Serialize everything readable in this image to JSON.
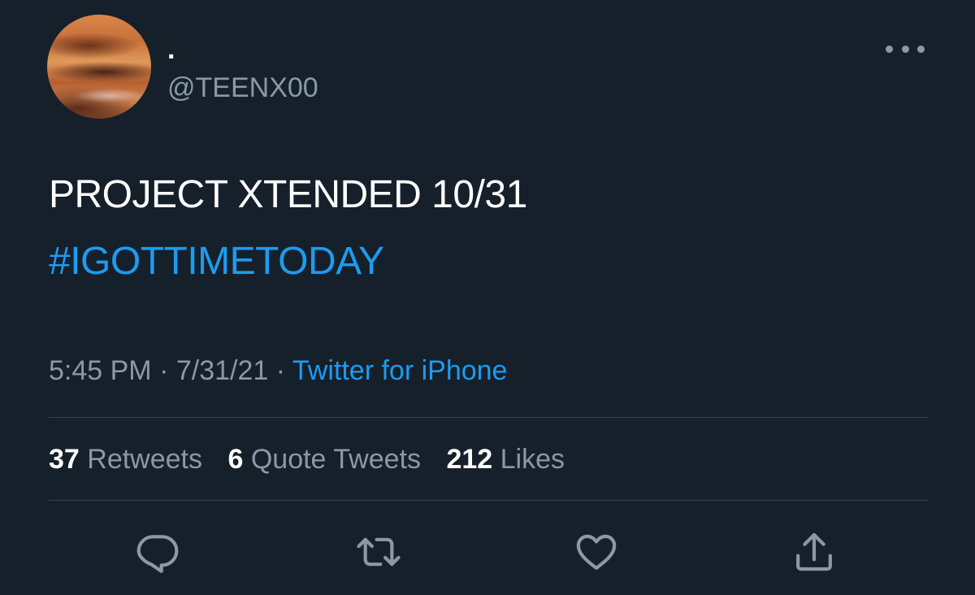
{
  "user": {
    "display_name": ".",
    "handle": "@TEENX00"
  },
  "tweet": {
    "text": "PROJECT XTENDED 10/31",
    "hashtag": "#IGOTTIMETODAY"
  },
  "meta": {
    "time": "5:45 PM",
    "separator1": " · ",
    "date": "7/31/21",
    "separator2": " · ",
    "source": "Twitter for iPhone"
  },
  "stats": {
    "retweets": {
      "count": "37",
      "label": " Retweets"
    },
    "quotes": {
      "count": "6",
      "label": " Quote Tweets"
    },
    "likes": {
      "count": "212",
      "label": " Likes"
    }
  },
  "icons": {
    "more": "more-horizontal-icon",
    "reply": "reply-icon",
    "retweet": "retweet-icon",
    "like": "heart-icon",
    "share": "share-icon"
  },
  "colors": {
    "background": "#15202b",
    "link": "#1d9bf0",
    "secondary_text": "#8b98a5",
    "divider": "#38444d"
  }
}
